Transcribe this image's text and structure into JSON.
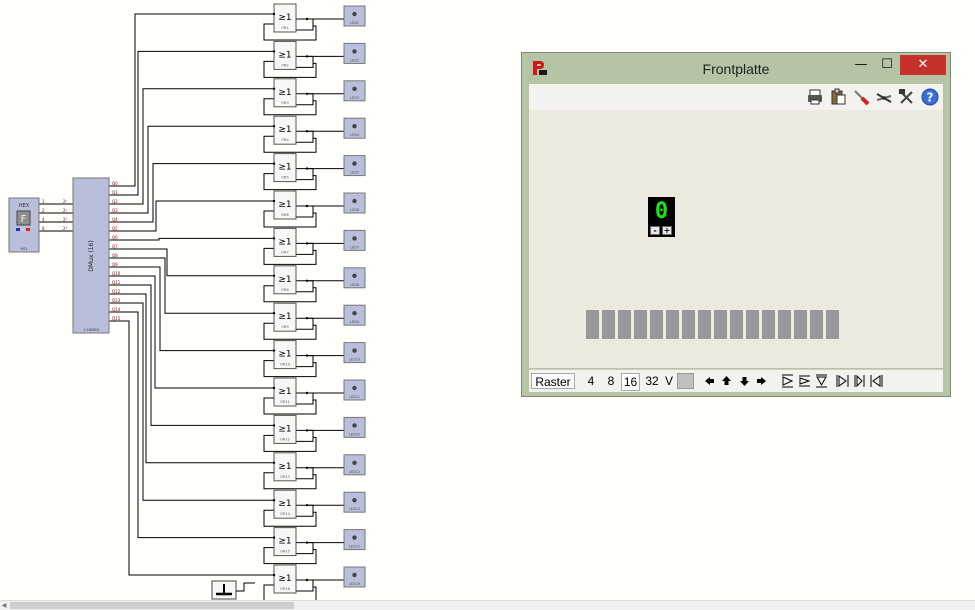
{
  "schematic": {
    "hex_switch": {
      "label": "HEX",
      "sub": "HS1",
      "glyph": "F",
      "pins_left": [
        "1",
        "2",
        "4",
        "8"
      ],
      "pins_right": [
        "2⁰",
        "2¹",
        "2²",
        "2³"
      ]
    },
    "demux": {
      "title": "DMux (16)",
      "sub": "1:16DMX",
      "inputs": [
        "2⁰",
        "2¹",
        "2²",
        "2³"
      ],
      "outputs": [
        "Q0",
        "Q1",
        "Q2",
        "Q3",
        "Q4",
        "Q5",
        "Q6",
        "Q7",
        "Q8",
        "Q9",
        "Q10",
        "Q11",
        "Q12",
        "Q13",
        "Q14",
        "Q15"
      ]
    },
    "or_symbol": "≥1",
    "or_gates": [
      "OR1",
      "OR2",
      "OR3",
      "OR4",
      "OR5",
      "OR6",
      "OR7",
      "OR8",
      "OR9",
      "OR10",
      "OR11",
      "OR12",
      "OR13",
      "OR14",
      "OR15",
      "OR16"
    ],
    "leds": [
      "LED1",
      "LED2",
      "LED3",
      "LED4",
      "LED5",
      "LED6",
      "LED7",
      "LED8",
      "LED9",
      "LED10",
      "LED11",
      "LED12",
      "LED13",
      "LED14",
      "LED15",
      "LED16"
    ]
  },
  "frontplate": {
    "title": "Frontplatte",
    "window_buttons": {
      "minimize": "—",
      "maximize": "☐",
      "close": "✕"
    },
    "toolbar_icons": [
      "printer-icon",
      "clipboard-icon",
      "screwdriver-icon",
      "pliers-icon",
      "tools-icon",
      "help-icon"
    ],
    "counter": {
      "value": "0",
      "minus": "-",
      "plus": "+"
    },
    "led_bar": {
      "count": 16,
      "color": "#999999"
    },
    "statusbar": {
      "raster": "Raster",
      "grid_options": [
        "4",
        "8",
        "16",
        "32"
      ],
      "selected": "16",
      "v_label": "V"
    }
  },
  "colors": {
    "wire": "#000000",
    "led_off": "#999999",
    "counter_digit": "#19e619",
    "close_button": "#c7312b",
    "window_frame": "#b6c4a6"
  }
}
